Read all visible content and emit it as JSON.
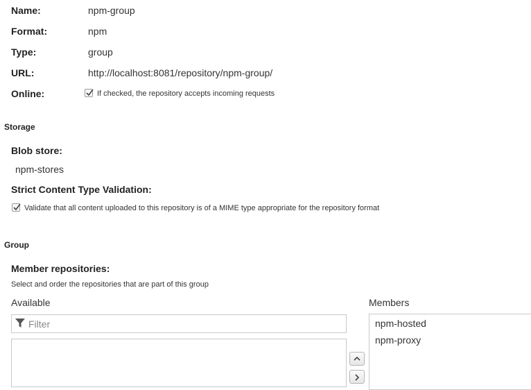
{
  "settings": {
    "name_label": "Name:",
    "name_value": "npm-group",
    "format_label": "Format:",
    "format_value": "npm",
    "type_label": "Type:",
    "type_value": "group",
    "url_label": "URL:",
    "url_value": "http://localhost:8081/repository/npm-group/",
    "online_label": "Online:",
    "online_checked": true,
    "online_text": "If checked, the repository accepts incoming requests"
  },
  "storage": {
    "section_title": "Storage",
    "blob_store_label": "Blob store:",
    "blob_store_value": "npm-stores",
    "strict_label": "Strict Content Type Validation:",
    "strict_checked": true,
    "strict_text": "Validate that all content uploaded to this repository is of a MIME type appropriate for the repository format"
  },
  "group": {
    "section_title": "Group",
    "members_label": "Member repositories:",
    "members_help": "Select and order the repositories that are part of this group",
    "available_label": "Available",
    "filter_placeholder": "Filter",
    "members_heading": "Members",
    "members": [
      "npm-hosted",
      "npm-proxy"
    ],
    "available": []
  },
  "icons": {
    "checkbox": "check-icon",
    "filter": "filter-icon",
    "move_up": "chevron-up-icon",
    "move_right": "chevron-right-icon"
  }
}
